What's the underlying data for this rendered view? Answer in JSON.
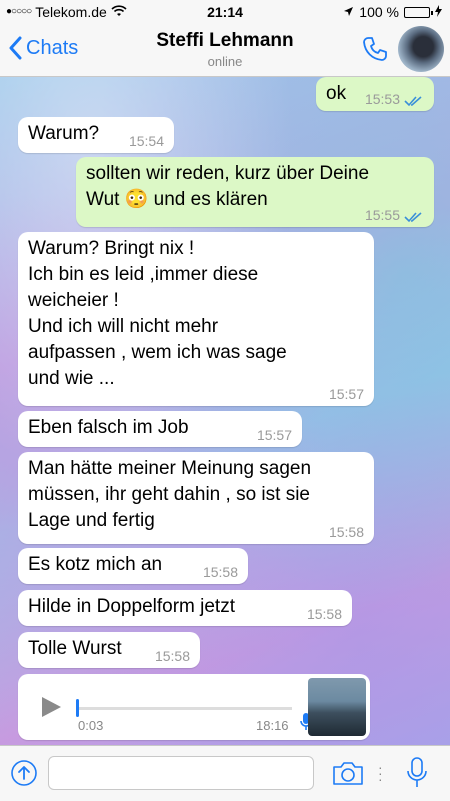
{
  "status_bar": {
    "carrier": "Telekom.de",
    "time": "21:14",
    "battery": "100 %",
    "battery_level": 1.0
  },
  "header": {
    "back_label": "Chats",
    "contact_name": "Steffi Lehmann",
    "contact_status": "online"
  },
  "messages": [
    {
      "dir": "out",
      "text": "ok",
      "time": "15:53"
    },
    {
      "dir": "in",
      "text": "Warum?",
      "time": "15:54"
    },
    {
      "dir": "out",
      "line1": "sollten wir reden, kurz über Deine",
      "line2_a": "Wut",
      "emoji": "😳",
      "line2_b": "und es klären",
      "time": "15:55"
    },
    {
      "dir": "in",
      "lines": [
        "Warum? Bringt nix !",
        "Ich bin es leid ,immer diese",
        "weicheier !",
        "Und ich will nicht mehr",
        "aufpassen , wem ich was sage",
        "und wie ..."
      ],
      "time": "15:57"
    },
    {
      "dir": "in",
      "text": "Eben falsch im Job",
      "time": "15:57"
    },
    {
      "dir": "in",
      "lines": [
        "Man hätte meiner Meinung sagen",
        "müssen, ihr geht dahin , so ist sie",
        "Lage und fertig"
      ],
      "time": "15:58"
    },
    {
      "dir": "in",
      "text": "Es kotz mich an",
      "time": "15:58"
    },
    {
      "dir": "in",
      "text": "Hilde in Doppelform jetzt",
      "time": "15:58"
    },
    {
      "dir": "in",
      "text": "Tolle Wurst",
      "time": "15:58"
    }
  ],
  "voice_message": {
    "duration": "0:03",
    "time": "18:16",
    "progress": 0.0
  },
  "input": {
    "placeholder": "",
    "value": ""
  },
  "colors": {
    "accent": "#1d7bf5",
    "outgoing_bubble": "#dcf8c6",
    "incoming_bubble": "#ffffff"
  },
  "icons": [
    "wifi-icon",
    "location-arrow-icon",
    "charging-icon",
    "back-chevron-icon",
    "phone-icon",
    "double-check-icon",
    "play-icon",
    "microphone-icon",
    "share-icon",
    "camera-icon"
  ]
}
